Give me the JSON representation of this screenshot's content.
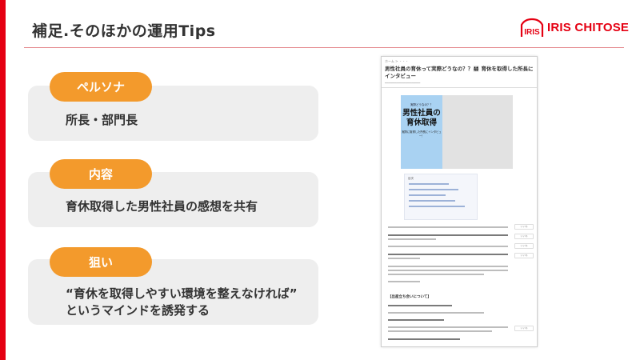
{
  "header": {
    "title": "補足.そのほかの運用Tips",
    "logo_text": "IRIS CHITOSE",
    "logo_mark": "IRIS",
    "accent_color": "#e50012"
  },
  "cards": [
    {
      "label": "ペルソナ",
      "text_lines": [
        "所長・部門長"
      ]
    },
    {
      "label": "内容",
      "text_lines": [
        "育休取得した男性社員の感想を共有"
      ]
    },
    {
      "label": "狙い",
      "text_lines": [
        "“育休を取得しやすい環境を整えなければ”",
        "というマインドを誘発する"
      ]
    }
  ],
  "pill_color": "#f39a2c",
  "screenshot": {
    "breadcrumb": "ホーム > ・・・",
    "article_title": "男性社員の育休って実際どうなの？？👨‍👩‍👧‍👦 育休を取得した所長にインタビュー",
    "hero_small": "実際どうなの？？",
    "hero_big": "男性社員の育休取得",
    "hero_sub": "実際に取得した所長にインタビュー！",
    "toc_heading": "目次",
    "section_heading": "【出産立ち会いについて】",
    "share_label": "いいね"
  }
}
